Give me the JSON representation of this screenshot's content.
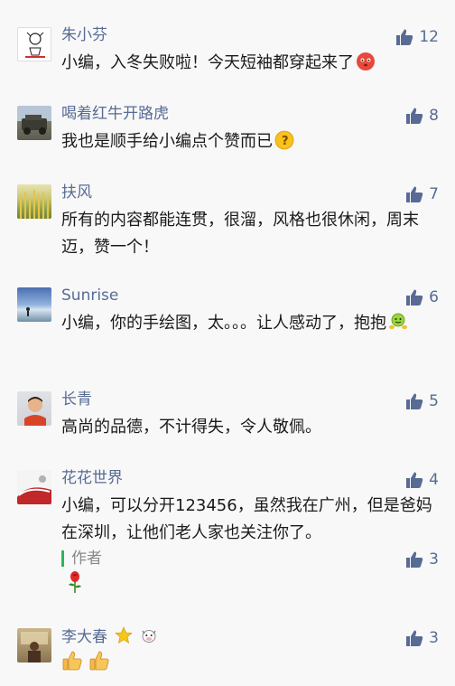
{
  "comments": [
    {
      "name": "朱小芬",
      "likes": "12",
      "text": "小编，入冬失败啦！今天短袖都穿起来了"
    },
    {
      "name": "喝着红牛开路虎",
      "likes": "8",
      "text": "我也是顺手给小编点个赞而已"
    },
    {
      "name": "扶风",
      "likes": "7",
      "text": "所有的内容都能连贯，很溜，风格也很休闲，周末迈，赞一个！"
    },
    {
      "name": "Sunrise",
      "likes": "6",
      "text": "小编，你的手绘图，太。。。让人感动了，抱抱"
    },
    {
      "name": "长青",
      "likes": "5",
      "text": "高尚的品德，不计得失，令人敬佩。"
    },
    {
      "name": "花花世界",
      "likes": "4",
      "text": "小编，可以分开123456，虽然我在广州，但是爸妈在深圳，让他们老人家也关注你了。"
    },
    {
      "name": "李大春",
      "likes": "3",
      "text": ""
    }
  ],
  "author_reply": {
    "label": "作者",
    "likes": "3"
  },
  "colors": {
    "accent": "#576b95",
    "reply_bar": "#2fb45a",
    "background": "#f8f8f8"
  }
}
